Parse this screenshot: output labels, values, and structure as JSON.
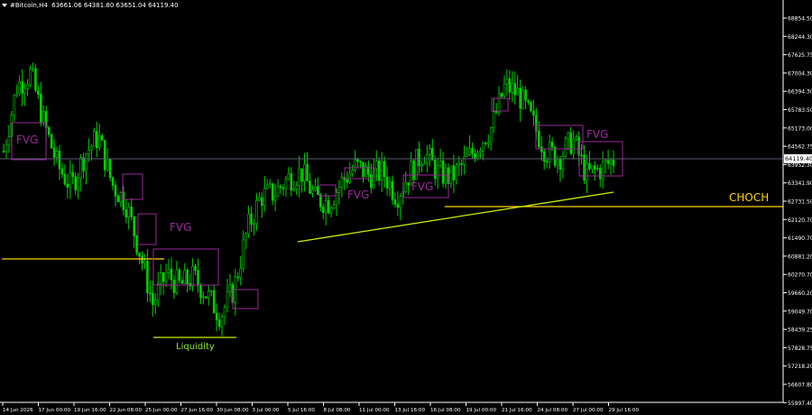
{
  "header": {
    "symbol_timeframe": "#Bitcoin,H4",
    "ohlc": "63661.06 64381.80 63651.04 64119.40"
  },
  "price_axis": {
    "labels": [
      "68854.50",
      "68244.30",
      "67625.75",
      "67004.30",
      "66394.30",
      "65783.50",
      "65173.00",
      "64562.75",
      "63952.30",
      "63341.90",
      "62731.50",
      "62120.70",
      "61490.70",
      "60881.20",
      "60270.70",
      "59660.20",
      "59049.70",
      "58439.25",
      "57828.75",
      "57218.20",
      "56607.80",
      "55997.40"
    ],
    "current_price": "64119.40"
  },
  "time_axis": {
    "labels": [
      "14 Jun 2026",
      "17 Jun 00:00",
      "19 Jun 16:00",
      "22 Jun 08:00",
      "25 Jun 00:00",
      "27 Jun 16:00",
      "30 Jun 08:00",
      "3 Jul 00:00",
      "5 Jul 16:00",
      "8 Jul 08:00",
      "11 Jul 00:00",
      "13 Jul 16:00",
      "16 Jul 08:00",
      "19 Jul 00:00",
      "21 Jul 16:00",
      "24 Jul 08:00",
      "27 Jul 00:00",
      "29 Jul 16:00"
    ]
  },
  "annotations": {
    "fvg_labels": [
      "FVG",
      "FVG",
      "FVG",
      "FVG",
      "FVG"
    ],
    "choch_label": "CHOCH",
    "liquidity_label": "Liquidity"
  },
  "colors": {
    "background": "#000000",
    "candle": "#00d000",
    "fvg_box": "#9c2a9c",
    "level_line": "#ffd400",
    "trend_line": "#c6f000",
    "grid_line": "#5a6070"
  },
  "chart_data": {
    "type": "candlestick",
    "symbol": "#Bitcoin",
    "timeframe": "H4",
    "last_price": 64119.4,
    "ylim": [
      55997.4,
      68854.5
    ],
    "xlim": [
      "14 Jun 2026",
      "29 Jul 16:00"
    ],
    "price_path": [
      [
        "14 Jun 2026",
        64400
      ],
      [
        "15 Jun",
        66600
      ],
      [
        "16 Jun",
        67000
      ],
      [
        "17 Jun",
        65300
      ],
      [
        "18 Jun",
        63900
      ],
      [
        "19 Jun",
        63200
      ],
      [
        "20 Jun",
        64300
      ],
      [
        "21 Jun",
        64900
      ],
      [
        "22 Jun",
        63300
      ],
      [
        "23 Jun",
        62700
      ],
      [
        "24 Jun",
        61100
      ],
      [
        "25 Jun",
        59300
      ],
      [
        "26 Jun",
        60300
      ],
      [
        "27 Jun",
        59900
      ],
      [
        "28 Jun",
        60200
      ],
      [
        "29 Jun",
        59600
      ],
      [
        "30 Jun",
        58900
      ],
      [
        "1 Jul",
        59800
      ],
      [
        "2 Jul",
        61800
      ],
      [
        "3 Jul",
        62900
      ],
      [
        "4 Jul",
        63000
      ],
      [
        "5 Jul",
        63500
      ],
      [
        "6 Jul",
        63700
      ],
      [
        "7 Jul",
        62800
      ],
      [
        "8 Jul",
        62700
      ],
      [
        "9 Jul",
        63400
      ],
      [
        "10 Jul",
        63900
      ],
      [
        "11 Jul",
        63600
      ],
      [
        "12 Jul",
        63700
      ],
      [
        "13 Jul",
        62900
      ],
      [
        "14 Jul",
        63700
      ],
      [
        "15 Jul",
        64400
      ],
      [
        "16 Jul",
        63700
      ],
      [
        "17 Jul",
        63500
      ],
      [
        "18 Jul",
        64000
      ],
      [
        "19 Jul",
        64600
      ],
      [
        "20 Jul",
        65200
      ],
      [
        "21 Jul",
        66600
      ],
      [
        "22 Jul",
        66300
      ],
      [
        "23 Jul",
        65400
      ],
      [
        "24 Jul",
        64400
      ],
      [
        "25 Jul",
        64200
      ],
      [
        "26 Jul",
        64800
      ],
      [
        "27 Jul",
        63600
      ],
      [
        "28 Jul",
        63800
      ],
      [
        "29 Jul",
        64100
      ]
    ],
    "levels": [
      {
        "name": "CHOCH",
        "price": 62580
      },
      {
        "name": "Liquidity",
        "price": 58120
      },
      {
        "price": 61050
      }
    ],
    "trendline": [
      [
        "5 Jul 16:00",
        61350
      ],
      [
        "29 Jul 16:00",
        62950
      ]
    ],
    "fvg_zones": [
      {
        "label": "FVG",
        "top": 65350,
        "bottom": 64300
      },
      {
        "label": "FVG",
        "top": 61850,
        "bottom": 61000
      },
      {
        "label": "FVG",
        "top": 63300,
        "bottom": 63050
      },
      {
        "label": "FVG",
        "top": 63600,
        "bottom": 63000
      },
      {
        "label": "FVG",
        "top": 64620,
        "bottom": 63700
      }
    ]
  }
}
